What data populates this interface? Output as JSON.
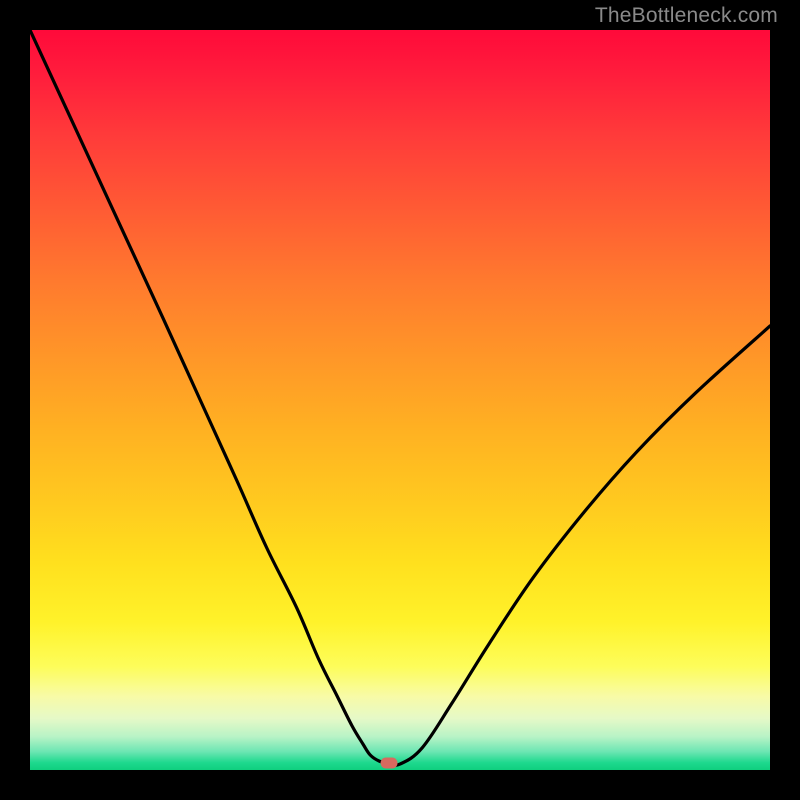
{
  "attribution": "TheBottleneck.com",
  "colors": {
    "frame": "#000000",
    "curve": "#000000",
    "marker": "#d76a5f",
    "gradient_top": "#ff0a3a",
    "gradient_bottom": "#0fcf7e"
  },
  "chart_data": {
    "type": "line",
    "title": "",
    "xlabel": "",
    "ylabel": "",
    "xlim": [
      0,
      100
    ],
    "ylim": [
      0,
      100
    ],
    "annotations": [],
    "series": [
      {
        "name": "bottleneck-curve",
        "x": [
          0,
          6,
          12,
          18,
          23,
          28,
          32,
          36,
          39,
          41.5,
          43.5,
          45,
          46,
          47.2,
          48.5,
          50,
          53,
          57,
          62,
          68,
          75,
          82,
          90,
          100
        ],
        "values": [
          100,
          87,
          74,
          61,
          50,
          39,
          30,
          22,
          15,
          10,
          6,
          3.5,
          2,
          1.2,
          0.9,
          0.8,
          3,
          9,
          17,
          26,
          35,
          43,
          51,
          60
        ]
      }
    ],
    "marker": {
      "x": 48.5,
      "y": 0.9
    }
  }
}
